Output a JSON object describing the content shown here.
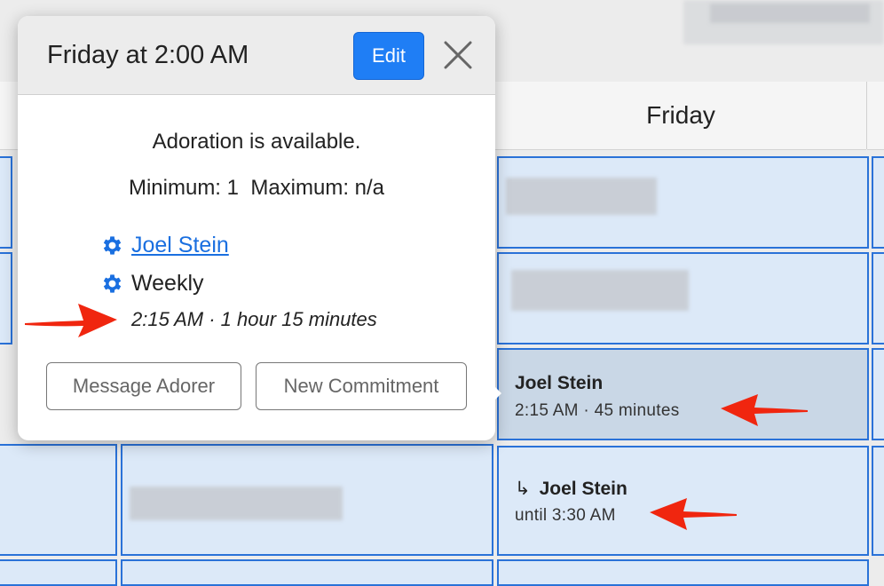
{
  "calendar": {
    "column_header": "Friday",
    "selected_cell": {
      "name": "Joel Stein",
      "time": "2:15 AM · 45 minutes"
    },
    "continuation_cell": {
      "arrow": "↳",
      "name": "Joel Stein",
      "time": "until 3:30 AM"
    }
  },
  "popover": {
    "title": "Friday at 2:00 AM",
    "edit_label": "Edit",
    "availability": "Adoration is available.",
    "min_max": "Minimum: 1  Maximum: n/a",
    "adorer_name": "Joel Stein",
    "frequency": "Weekly",
    "slot": "2:15 AM · 1 hour 15 minutes",
    "message_button": "Message Adorer",
    "new_commitment_button": "New Commitment",
    "icons": {
      "close": "close-icon",
      "gear": "gear-icon"
    }
  },
  "colors": {
    "accent": "#1f7ef5",
    "cell_fill": "#dce9f8",
    "cell_border": "#2a72d8",
    "annotation_arrow": "#f0260f"
  }
}
